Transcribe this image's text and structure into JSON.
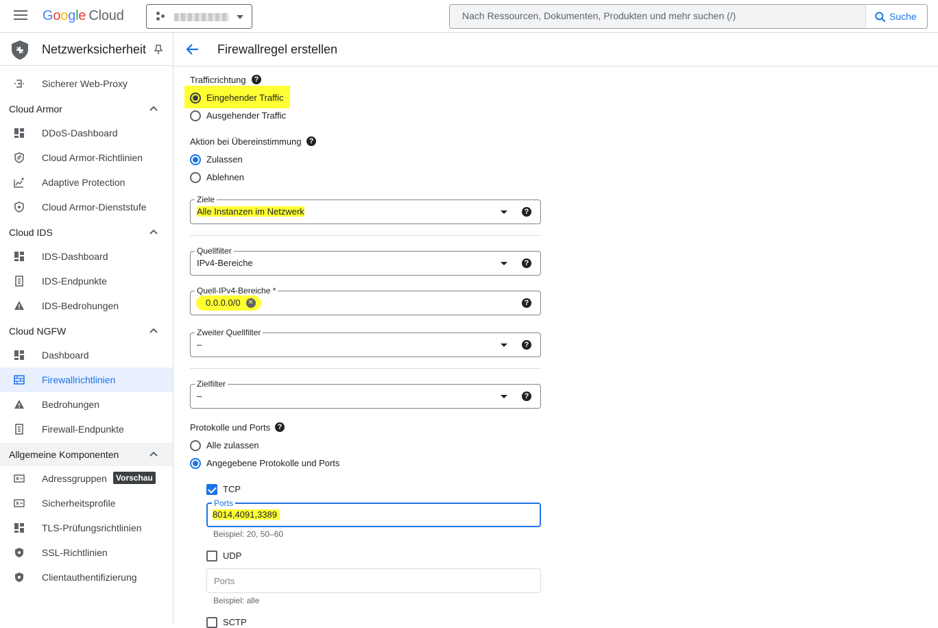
{
  "topbar": {
    "logo_word": "Google",
    "logo_product": "Cloud",
    "search_placeholder": "Nach Ressourcen, Dokumenten, Produkten und mehr suchen (/)",
    "search_button": "Suche"
  },
  "sidebar": {
    "title": "Netzwerksicherheit",
    "items": [
      {
        "label": "Sicherer Web-Proxy",
        "icon": "web-proxy-icon"
      },
      {
        "label": "DDoS-Dashboard",
        "icon": "dashboard-icon"
      },
      {
        "label": "Cloud Armor-Richtlinien",
        "icon": "armor-policy-icon"
      },
      {
        "label": "Adaptive Protection",
        "icon": "adaptive-protection-icon"
      },
      {
        "label": "Cloud Armor-Dienststufe",
        "icon": "shield-icon"
      },
      {
        "label": "IDS-Dashboard",
        "icon": "dashboard-icon"
      },
      {
        "label": "IDS-Endpunkte",
        "icon": "endpoint-icon"
      },
      {
        "label": "IDS-Bedrohungen",
        "icon": "threat-icon"
      },
      {
        "label": "Dashboard",
        "icon": "dashboard-icon"
      },
      {
        "label": "Firewallrichtlinien",
        "icon": "firewall-icon"
      },
      {
        "label": "Bedrohungen",
        "icon": "threat-icon"
      },
      {
        "label": "Firewall-Endpunkte",
        "icon": "endpoint-icon"
      },
      {
        "label": "Adressgruppen",
        "icon": "address-group-icon"
      },
      {
        "label": "Sicherheitsprofile",
        "icon": "security-profile-icon"
      },
      {
        "label": "TLS-Prüfungsrichtlinien",
        "icon": "dashboard-icon"
      },
      {
        "label": "SSL-Richtlinien",
        "icon": "shield-icon"
      },
      {
        "label": "Clientauthentifizierung",
        "icon": "shield-icon"
      }
    ],
    "sections": [
      "Cloud Armor",
      "Cloud IDS",
      "Cloud NGFW",
      "Allgemeine Komponenten"
    ],
    "badge": "Vorschau",
    "active_item": "Firewallrichtlinien"
  },
  "page": {
    "title": "Firewallregel erstellen"
  },
  "form": {
    "traffic_direction": {
      "label": "Trafficrichtung",
      "options": [
        "Eingehender Traffic",
        "Ausgehender Traffic"
      ],
      "selected": "Eingehender Traffic"
    },
    "action": {
      "label": "Aktion bei Übereinstimmung",
      "options": [
        "Zulassen",
        "Ablehnen"
      ],
      "selected": "Zulassen"
    },
    "targets": {
      "label": "Ziele",
      "value": "Alle Instanzen im Netzwerk"
    },
    "source_filter": {
      "label": "Quellfilter",
      "value": "IPv4-Bereiche"
    },
    "source_ranges": {
      "label": "Quell-IPv4-Bereiche *",
      "chip": "0.0.0.0/0"
    },
    "second_source_filter": {
      "label": "Zweiter Quellfilter",
      "value": "–"
    },
    "target_filter": {
      "label": "Zielfilter",
      "value": "–"
    },
    "protocols": {
      "label": "Protokolle und Ports",
      "options": [
        "Alle zulassen",
        "Angegebene Protokolle und Ports"
      ],
      "selected": "Angegebene Protokolle und Ports",
      "tcp": {
        "label": "TCP",
        "checked": true,
        "ports_label": "Ports",
        "ports_value": "8014,4091,3389",
        "hint": "Beispiel: 20, 50–60"
      },
      "udp": {
        "label": "UDP",
        "checked": false,
        "ports_placeholder": "Ports",
        "hint": "Beispiel: alle"
      },
      "sctp": {
        "label": "SCTP",
        "checked": false
      }
    }
  },
  "colors": {
    "accent": "#1a73e8",
    "highlight": "#ffff33",
    "active_bg": "#e8f0fe"
  }
}
